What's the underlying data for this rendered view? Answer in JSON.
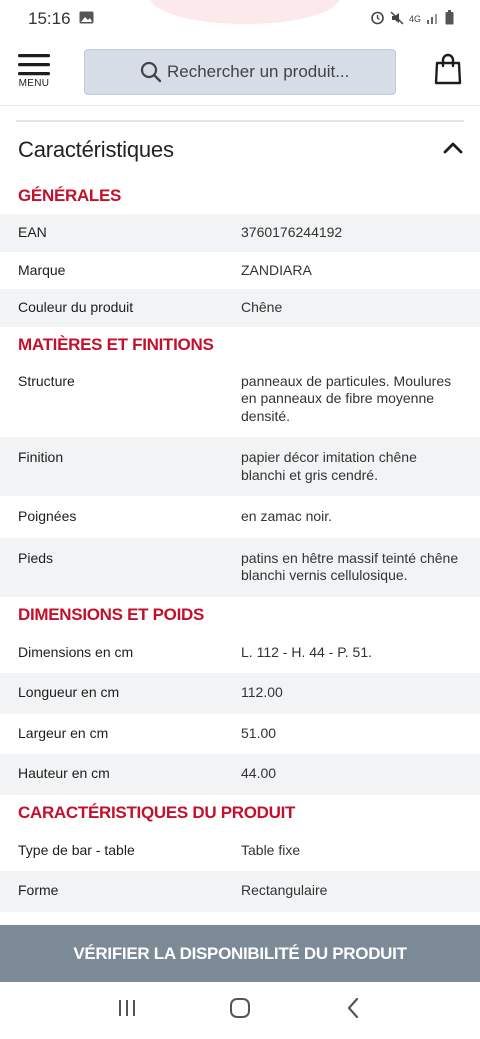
{
  "status_bar": {
    "time": "15:16",
    "left_icons": [
      "image-icon"
    ],
    "right_icons": [
      "alarm-icon",
      "mute-icon",
      "network-4g-icon",
      "signal-icon",
      "battery-icon"
    ],
    "network_label": "4G"
  },
  "header": {
    "menu_label": "MENU",
    "search_placeholder": "Rechercher un produit...",
    "icons": [
      "hamburger-icon",
      "search-icon",
      "shopping-bag-icon"
    ]
  },
  "characteristics": {
    "title": "Caractéristiques",
    "expanded": true,
    "groups": [
      {
        "title": "GÉNÉRALES",
        "rows": [
          {
            "key": "EAN",
            "value": "3760176244192"
          },
          {
            "key": "Marque",
            "value": "ZANDIARA"
          },
          {
            "key": "Couleur du produit",
            "value": "Chêne"
          }
        ]
      },
      {
        "title": "MATIÈRES ET FINITIONS",
        "rows": [
          {
            "key": "Structure",
            "value": "panneaux de particules. Moulures en panneaux de fibre moyenne densité."
          },
          {
            "key": "Finition",
            "value": "papier décor imitation chêne blanchi et gris cendré."
          },
          {
            "key": "Poignées",
            "value": "en zamac noir."
          },
          {
            "key": "Pieds",
            "value": "patins en hêtre massif teinté chêne blanchi vernis cellulosique."
          }
        ]
      },
      {
        "title": "DIMENSIONS ET POIDS",
        "rows": [
          {
            "key": "Dimensions en cm",
            "value": "L. 112 - H. 44 - P. 51."
          },
          {
            "key": "Longueur en cm",
            "value": "112.00"
          },
          {
            "key": "Largeur en cm",
            "value": "51.00"
          },
          {
            "key": "Hauteur en cm",
            "value": "44.00"
          }
        ]
      },
      {
        "title": "CARACTÉRISTIQUES DU PRODUIT",
        "rows": [
          {
            "key": "Type de bar - table",
            "value": "Table fixe"
          },
          {
            "key": "Forme",
            "value": "Rectangulaire"
          }
        ]
      }
    ]
  },
  "cta": {
    "label": "VÉRIFIER LA DISPONIBILITÉ DU PRODUIT"
  },
  "nav_bar": {
    "buttons": [
      "recent-apps-icon",
      "home-icon",
      "back-icon"
    ]
  },
  "colors": {
    "accent_red": "#c3102b",
    "cta_background": "#7c8a98",
    "search_background": "#d6dde6",
    "row_shade": "#f2f3f4"
  }
}
